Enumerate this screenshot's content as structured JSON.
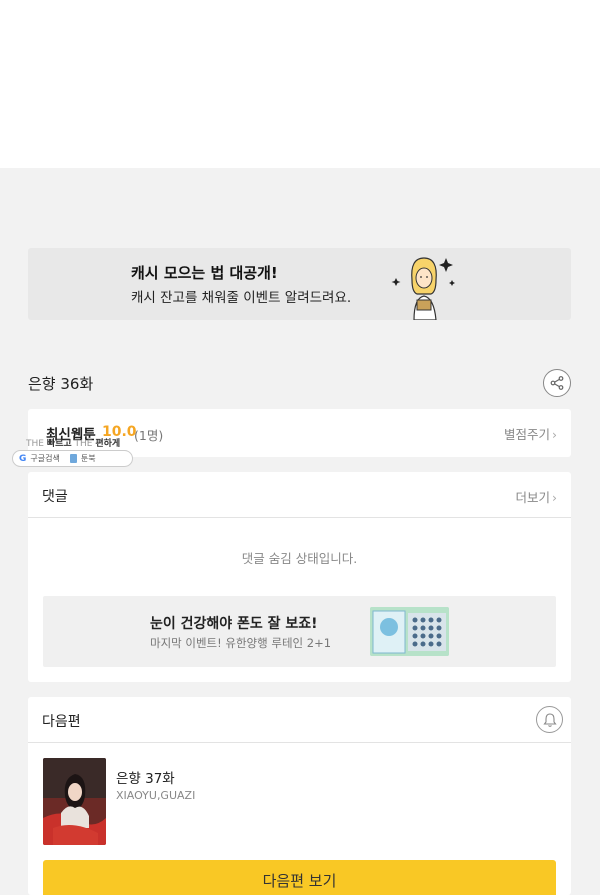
{
  "banner": {
    "title": "캐시 모으는 법 대공개!",
    "subtitle": "캐시 잔고를 채워줄 이벤트 알려드려요."
  },
  "episode": {
    "title": "은향 36화"
  },
  "rating": {
    "label": "최신웹툰",
    "score": "10.0",
    "count": "(1명)",
    "action": "별점주기"
  },
  "overlay": {
    "line1_a": "THE",
    "line1_b": "빠르고",
    "line1_c": "THE",
    "line1_d": "편하게",
    "google_label": "구글검색",
    "book_label": "툰북"
  },
  "comments": {
    "heading": "댓글",
    "more": "더보기",
    "empty_message": "댓글 숨김 상태입니다."
  },
  "ad": {
    "title": "눈이 건강해야 폰도 잘 보죠!",
    "subtitle": "마지막 이벤트! 유한양행 루테인 2+1"
  },
  "next": {
    "heading": "다음편",
    "episode_title": "은향 37화",
    "author": "XIAOYU,GUAZI",
    "button_label": "다음편 보기"
  },
  "colors": {
    "accent_yellow": "#f9c825",
    "rating_orange": "#f5a623",
    "page_bg": "#f2f2f2"
  },
  "icons": {
    "share": "share-icon",
    "bell": "bell-icon",
    "chevron": "chevron-right-icon"
  }
}
